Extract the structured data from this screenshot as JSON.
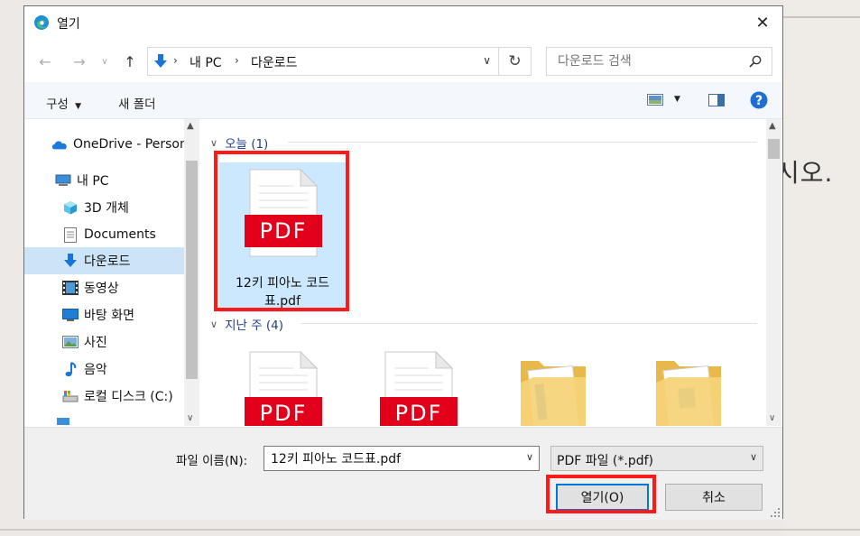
{
  "window": {
    "title": "열기"
  },
  "nav": {
    "breadcrumb": [
      "내 PC",
      "다운로드"
    ],
    "search_placeholder": "다운로드 검색"
  },
  "toolbar": {
    "organize": "구성",
    "new_folder": "새 폴더"
  },
  "navpane": {
    "items": [
      {
        "label": "OneDrive - Person",
        "icon": "onedrive-icon"
      },
      {
        "label": "내 PC",
        "icon": "pc-icon"
      },
      {
        "label": "3D 개체",
        "icon": "3d-objects-icon"
      },
      {
        "label": "Documents",
        "icon": "documents-icon"
      },
      {
        "label": "다운로드",
        "icon": "downloads-icon",
        "selected": true
      },
      {
        "label": "동영상",
        "icon": "videos-icon"
      },
      {
        "label": "바탕 화면",
        "icon": "desktop-icon"
      },
      {
        "label": "사진",
        "icon": "pictures-icon"
      },
      {
        "label": "음악",
        "icon": "music-icon"
      },
      {
        "label": "로컬 디스크 (C:)",
        "icon": "disk-icon"
      }
    ]
  },
  "files": {
    "groups": [
      {
        "header": "오늘 (1)"
      },
      {
        "header": "지난 주 (4)"
      }
    ],
    "today": [
      {
        "name": "12키 피아노 코드표.pdf",
        "type": "pdf",
        "badge": "PDF"
      }
    ],
    "last_week": [
      {
        "type": "pdf",
        "badge": "PDF"
      },
      {
        "type": "pdf",
        "badge": "PDF"
      },
      {
        "type": "folder"
      },
      {
        "type": "folder"
      }
    ]
  },
  "bottom": {
    "filename_label": "파일 이름(N):",
    "filename_value": "12키 피아노 코드표.pdf",
    "filetype": "PDF 파일 (*.pdf)",
    "open_label": "열기(O)",
    "cancel_label": "취소"
  },
  "background": {
    "text": "시오."
  },
  "colors": {
    "accent": "#0078d7",
    "highlight": "#ff1a1a",
    "selection": "#cce8ff",
    "pdf_red": "#e2001a"
  }
}
